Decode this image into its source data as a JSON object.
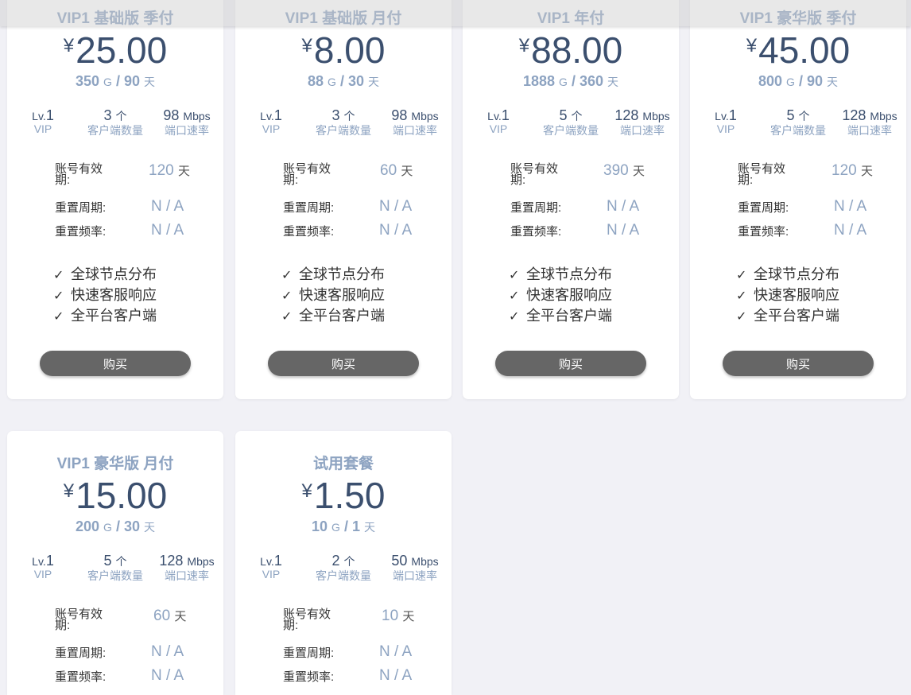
{
  "currency_symbol": "¥",
  "labels": {
    "lv_prefix": "Lv.",
    "vip": "VIP",
    "client_unit": "个",
    "client_label": "客户端数量",
    "speed_unit": "Mbps",
    "speed_label": "端口速率",
    "validity": "账号有效期:",
    "reset_period": "重置周期:",
    "reset_freq": "重置频率:",
    "day_unit": "天",
    "gb_unit": "G",
    "buy": "购买",
    "check_icon": "✓"
  },
  "plans": [
    {
      "title": "VIP1 基础版 季付",
      "price": "25.00",
      "traffic": "350",
      "days": "90",
      "level": "1",
      "clients": "3",
      "speed": "98",
      "validity": "120",
      "reset_period": "N / A",
      "reset_freq": "N / A",
      "features": [
        "全球节点分布",
        "快速客服响应",
        "全平台客户端"
      ]
    },
    {
      "title": "VIP1 基础版 月付",
      "price": "8.00",
      "traffic": "88",
      "days": "30",
      "level": "1",
      "clients": "3",
      "speed": "98",
      "validity": "60",
      "reset_period": "N / A",
      "reset_freq": "N / A",
      "features": [
        "全球节点分布",
        "快速客服响应",
        "全平台客户端"
      ]
    },
    {
      "title": "VIP1 年付",
      "price": "88.00",
      "traffic": "1888",
      "days": "360",
      "level": "1",
      "clients": "5",
      "speed": "128",
      "validity": "390",
      "reset_period": "N / A",
      "reset_freq": "N / A",
      "features": [
        "全球节点分布",
        "快速客服响应",
        "全平台客户端"
      ]
    },
    {
      "title": "VIP1 豪华版 季付",
      "price": "45.00",
      "traffic": "800",
      "days": "90",
      "level": "1",
      "clients": "5",
      "speed": "128",
      "validity": "120",
      "reset_period": "N / A",
      "reset_freq": "N / A",
      "features": [
        "全球节点分布",
        "快速客服响应",
        "全平台客户端"
      ]
    },
    {
      "title": "VIP1 豪华版 月付",
      "price": "15.00",
      "traffic": "200",
      "days": "30",
      "level": "1",
      "clients": "5",
      "speed": "128",
      "validity": "60",
      "reset_period": "N / A",
      "reset_freq": "N / A",
      "features": []
    },
    {
      "title": "试用套餐",
      "price": "1.50",
      "traffic": "10",
      "days": "1",
      "level": "1",
      "clients": "2",
      "speed": "50",
      "validity": "10",
      "reset_period": "N / A",
      "reset_freq": "N / A",
      "features": []
    }
  ]
}
